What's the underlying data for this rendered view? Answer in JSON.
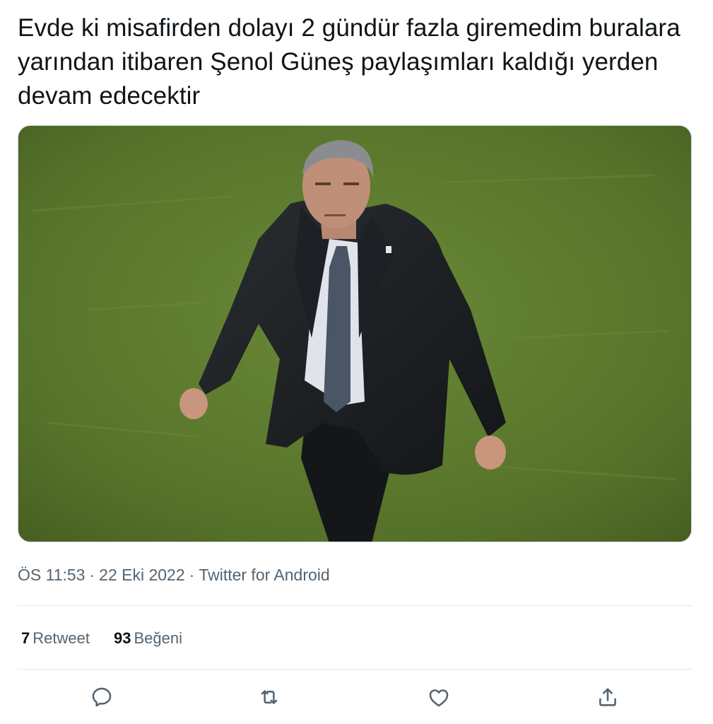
{
  "tweet": {
    "text": "Evde ki misafirden dolayı 2 gündür fazla giremedim buralara yarından itibaren Şenol Güneş paylaşımları kaldığı yerden devam edecektir",
    "time": "ÖS 11:53",
    "date": "22 Eki 2022",
    "source": "Twitter for Android",
    "separator": "·"
  },
  "stats": {
    "retweets_count": "7",
    "retweets_label": "Retweet",
    "likes_count": "93",
    "likes_label": "Beğeni"
  },
  "actions": [
    {
      "name": "reply-icon"
    },
    {
      "name": "retweet-icon"
    },
    {
      "name": "like-icon"
    },
    {
      "name": "share-icon"
    }
  ],
  "colors": {
    "text_primary": "#0f1419",
    "text_secondary": "#536471",
    "divider": "#e3e8eb",
    "grass": "#5b7a2e"
  }
}
